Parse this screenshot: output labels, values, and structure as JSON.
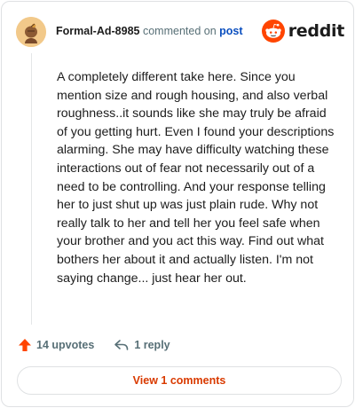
{
  "header": {
    "username": "Formal-Ad-8985",
    "verb": "commented on",
    "target": "post",
    "brand": "reddit"
  },
  "comment": {
    "text": "A completely different take here. Since you mention size and rough housing, and also verbal roughness..it sounds like she may truly be afraid of you getting hurt. Even I found your descriptions alarming. She may have difficulty watching these interactions out of fear not necessarily out of a need to be controlling. And your response telling her to just shut up was just plain rude. Why not really talk to her and tell her you feel safe when your brother and you act this way. Find out what bothers her about it and actually listen. I'm not saying change... just hear her out."
  },
  "actions": {
    "upvotes": "14 upvotes",
    "replies": "1 reply"
  },
  "footer": {
    "view_comments": "View 1 comments"
  },
  "colors": {
    "brand_orange": "#ff4500",
    "link_blue": "#0b4fbf",
    "button_text": "#d93a00",
    "muted": "#576f76"
  },
  "icons": [
    "user-avatar",
    "reddit-snoo-icon",
    "upvote-arrow-icon",
    "reply-arrow-icon"
  ]
}
